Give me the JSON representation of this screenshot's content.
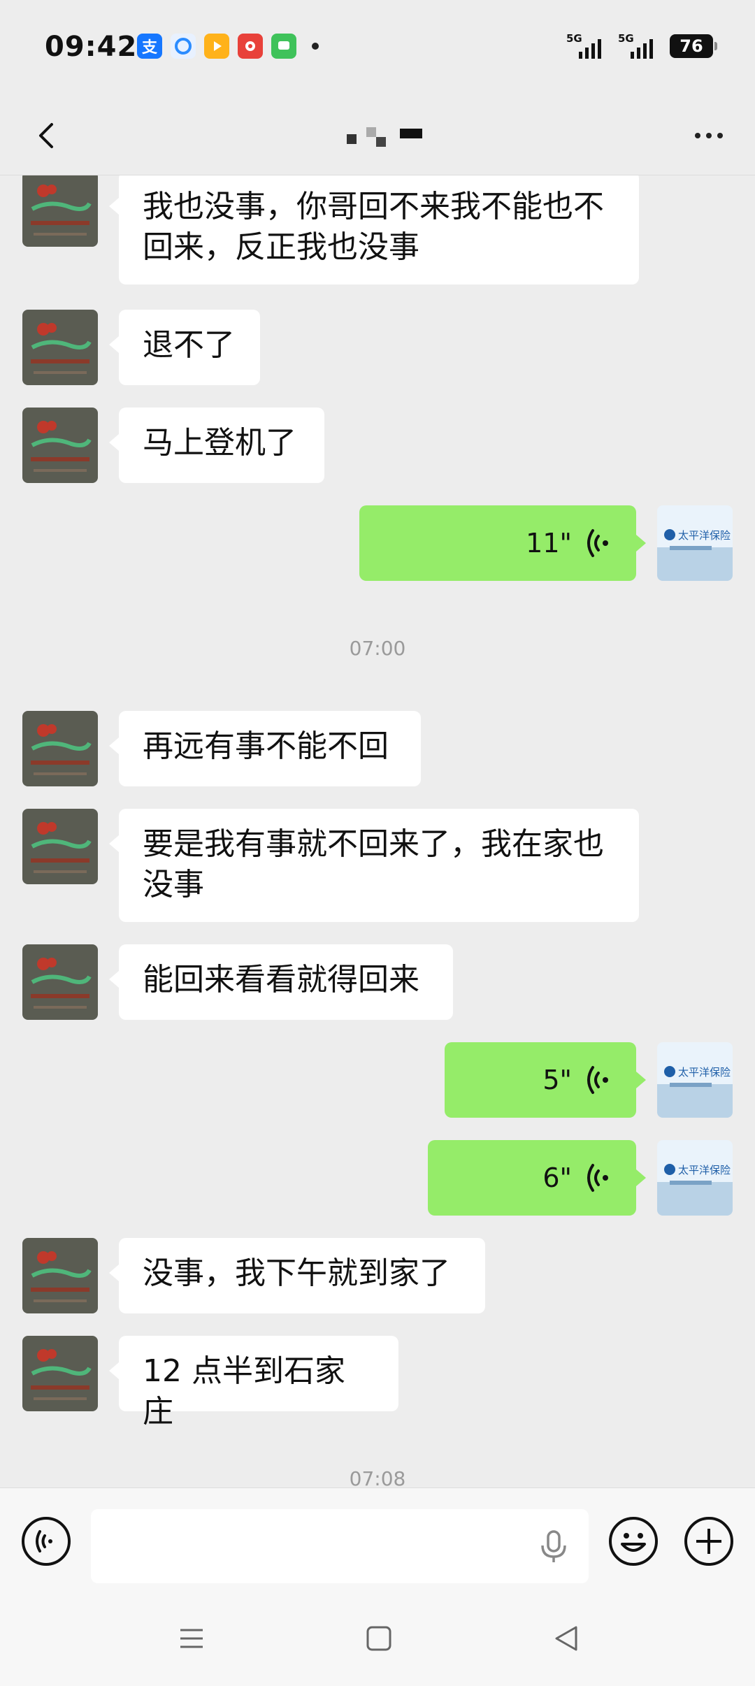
{
  "status_bar": {
    "time": "09:42",
    "app_icons": [
      "支",
      "",
      "",
      "",
      ""
    ],
    "signal_1": "5G",
    "signal_2": "5G",
    "battery": "76"
  },
  "header": {
    "title": ""
  },
  "messages": [
    {
      "side": "left",
      "type": "text",
      "text": "我也没事，你哥回不来我不能也不回来，反正我也没事"
    },
    {
      "side": "left",
      "type": "text",
      "text": "退不了"
    },
    {
      "side": "left",
      "type": "text",
      "text": "马上登机了"
    },
    {
      "side": "right",
      "type": "voice",
      "duration": "11\""
    },
    {
      "type": "time",
      "text": "07:00"
    },
    {
      "side": "left",
      "type": "text",
      "text": "再远有事不能不回"
    },
    {
      "side": "left",
      "type": "text",
      "text": "要是我有事就不回来了，我在家也没事"
    },
    {
      "side": "left",
      "type": "text",
      "text": "能回来看看就得回来"
    },
    {
      "side": "right",
      "type": "voice",
      "duration": "5\""
    },
    {
      "side": "right",
      "type": "voice",
      "duration": "6\""
    },
    {
      "side": "left",
      "type": "text",
      "text": "没事，我下午就到家了"
    },
    {
      "side": "left",
      "type": "text",
      "text": "12 点半到石家庄"
    },
    {
      "type": "time",
      "text": "07:08"
    }
  ],
  "right_avatar_text": "太平洋保险",
  "colors": {
    "background": "#ededed",
    "voice_bubble": "#95ec69",
    "text_bubble": "#ffffff"
  }
}
